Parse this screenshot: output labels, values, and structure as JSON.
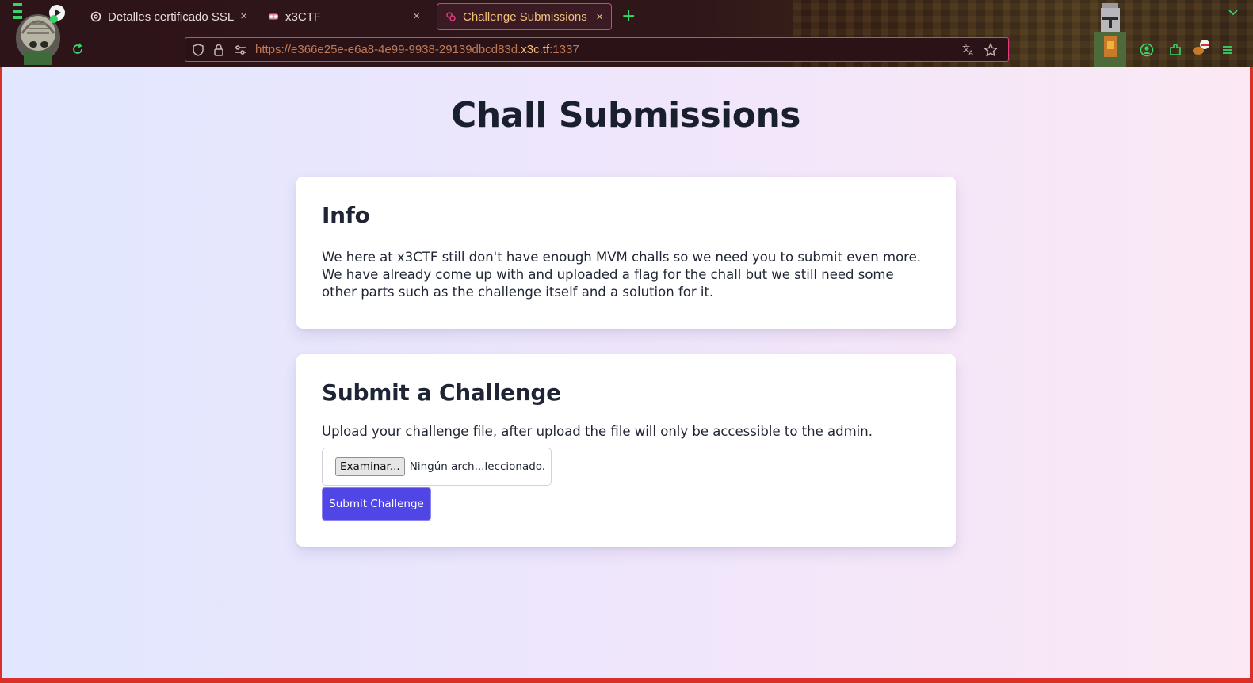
{
  "browser": {
    "tabs": [
      {
        "title": "Detalles certificado SSL",
        "active": false
      },
      {
        "title": "x3CTF",
        "active": false
      },
      {
        "title": "Challenge Submissions",
        "active": true
      }
    ],
    "new_tab_symbol": "+",
    "close_symbol": "×",
    "url": {
      "prefix": "https://e366e25e-e6a8-4e99-9938-29139dbcd83d.",
      "host": "x3c.tf",
      "suffix": ":1337"
    },
    "colors": {
      "accent_border": "#e8387f",
      "active_tab_text": "#f3c07a",
      "icon_green": "#38d46a",
      "url_text": "#c07a56"
    }
  },
  "page": {
    "title": "Chall Submissions",
    "info": {
      "heading": "Info",
      "body": "We here at x3CTF still don't have enough MVM challs so we need you to submit even more. We have already come up with and uploaded a flag for the chall but we still need some other parts such as the challenge itself and a solution for it."
    },
    "submit": {
      "heading": "Submit a Challenge",
      "description": "Upload your challenge file, after upload the file will only be accessible to the admin.",
      "browse_label": "Examinar...",
      "file_status": "Ningún arch...leccionado.",
      "submit_label": "Submit Challenge"
    },
    "colors": {
      "primary_button": "#4f46e5",
      "heading_text": "#1a1f2e"
    }
  }
}
